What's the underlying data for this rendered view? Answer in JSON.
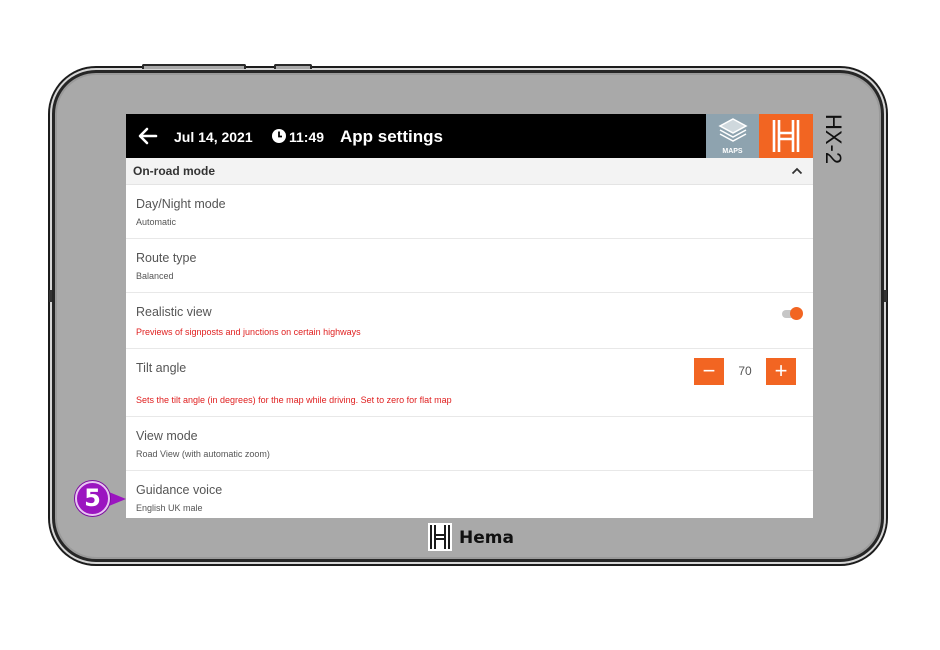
{
  "device": {
    "model": "HX-2",
    "brand": "Hema"
  },
  "topbar": {
    "date": "Jul 14, 2021",
    "time": "11:49",
    "title": "App settings",
    "maps_label": "MAPS"
  },
  "section": {
    "title": "On-road mode"
  },
  "rows": [
    {
      "title": "Day/Night mode",
      "sub": "Automatic"
    },
    {
      "title": "Route type",
      "sub": "Balanced"
    },
    {
      "title": "Realistic view",
      "sub": "Previews of signposts and junctions on certain highways",
      "toggle_on": true
    },
    {
      "title": "Tilt angle",
      "sub": "Sets the tilt angle (in degrees) for the map while driving. Set to zero for flat map",
      "value": "70",
      "minus": "−",
      "plus": "+"
    },
    {
      "title": "View mode",
      "sub": "Road View (with automatic zoom)"
    },
    {
      "title": "Guidance voice",
      "sub": "English UK male"
    }
  ],
  "callout": {
    "number": "5"
  },
  "colors": {
    "accent": "#f26522",
    "maps_bg": "#8ea3af",
    "callout": "#9b15c0",
    "warning_text": "#e02020"
  }
}
